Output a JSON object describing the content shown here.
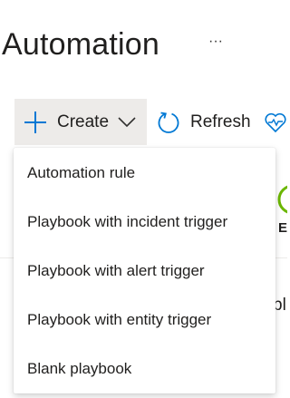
{
  "page": {
    "title": "Automation",
    "more_label": "···"
  },
  "toolbar": {
    "create_label": "Create",
    "refresh_label": "Refresh"
  },
  "create_menu": {
    "items": [
      {
        "label": "Automation rule"
      },
      {
        "label": "Playbook with incident trigger"
      },
      {
        "label": "Playbook with alert trigger"
      },
      {
        "label": "Playbook with entity trigger"
      },
      {
        "label": "Blank playbook"
      }
    ]
  },
  "background": {
    "partial_e": "E",
    "partial_pl": "bl"
  },
  "colors": {
    "accent": "#0078d4",
    "create_button_bg": "#edebe9",
    "status_ring": "#6bb700",
    "text": "#201f1e"
  },
  "icons": {
    "create": "plus-icon",
    "create_dropdown": "chevron-down-icon",
    "refresh": "refresh-icon",
    "third_toolbar_button": "heart-pulse-icon"
  }
}
